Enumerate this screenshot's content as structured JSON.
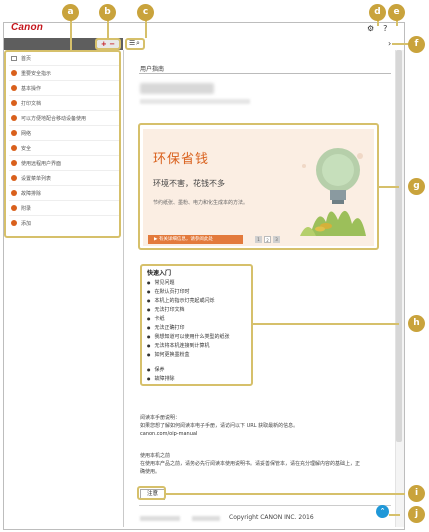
{
  "app": {
    "logo_text": "Canon",
    "help_icon": "?"
  },
  "toolbar": {
    "expand_collapse": "+ −",
    "list_icon": "☰",
    "search_icon": "⌕",
    "next_icon": "›",
    "settings_icon": "⚙"
  },
  "sidebar": {
    "items": [
      {
        "label": "首页",
        "icon": "home-icon"
      },
      {
        "label": "重要安全指示"
      },
      {
        "label": "基本操作"
      },
      {
        "label": "打印文档"
      },
      {
        "label": "可以方便地配合移动设备使用"
      },
      {
        "label": "网络"
      },
      {
        "label": "安全"
      },
      {
        "label": "使用远程用户界面"
      },
      {
        "label": "设置菜单列表"
      },
      {
        "label": "故障排除"
      },
      {
        "label": "附录"
      },
      {
        "label": "添加"
      }
    ]
  },
  "content": {
    "heading": "用户指南",
    "banner": {
      "title": "环保省钱",
      "subtitle": "环境不害，花钱不多",
      "description": "节约纸张、墨粉、电力和化生成本的方法。",
      "cta": "▶ 有关详细信息，请参阅此处",
      "pager": [
        "1",
        "2",
        "3"
      ]
    },
    "quick_start": {
      "title": "快速入门",
      "items": [
        "常见问题",
        "在默认页打印时",
        "本机上的指示灯亮起或闪烁",
        "无法打印文档",
        "卡纸",
        "无法正确打印",
        "我想知道可以使用什么类型的纸张",
        "无法将本机连接到计算机",
        "如何更换墨粉盒"
      ],
      "extra_items": [
        "保养",
        "故障排除"
      ]
    },
    "help_text": {
      "line1": "阅读本手册说明：",
      "line2": "如果您想了解如何阅读本电子手册，请访问以下 URL 获取最新的信息。",
      "url": "canon.com/oip-manual",
      "line3": "使用本机之前",
      "line4": "在使用本产品之前，请务必先行阅读本使用说明书。请妥善保管本，请在充分理解内容的基础上，正",
      "line5": "确使用。"
    },
    "notice_button": "注意",
    "copyright": "Copyright CANON INC. 2016"
  },
  "callouts": [
    "a",
    "b",
    "c",
    "d",
    "e",
    "f",
    "g",
    "h",
    "i",
    "j"
  ],
  "colors": {
    "brand": "#c4161c",
    "accent_orange": "#d9601c",
    "callout": "#c9a33c",
    "to_top": "#1f98d8"
  }
}
